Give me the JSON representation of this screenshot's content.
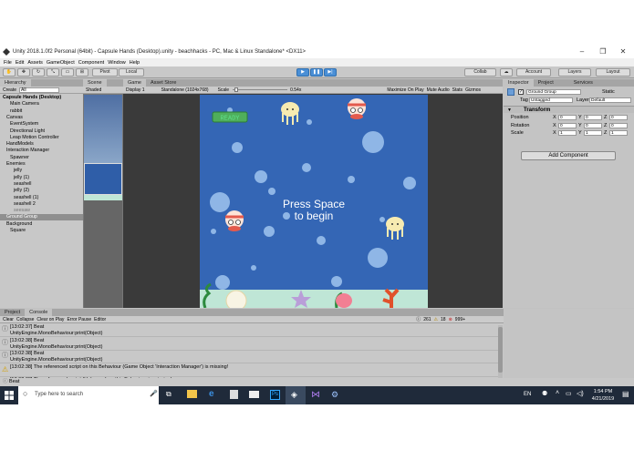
{
  "window": {
    "title": "Unity 2018.1.0f2 Personal (64bit) - Capsule Hands (Desktop).unity - beachhacks - PC, Mac & Linux Standalone* <DX11>"
  },
  "menu": [
    "File",
    "Edit",
    "Assets",
    "GameObject",
    "Component",
    "Window",
    "Help"
  ],
  "toolbar": {
    "pivot": "Pivot",
    "local": "Local",
    "collab": "Collab",
    "account": "Account",
    "layers": "Layers",
    "layout": "Layout"
  },
  "hierarchy": {
    "tab": "Hierarchy",
    "create": "Create",
    "search_placeholder": "All",
    "items": [
      {
        "label": "Capsule Hands (Desktop)",
        "indent": 0,
        "bold": true
      },
      {
        "label": "Main Camera",
        "indent": 2
      },
      {
        "label": "rabbit",
        "indent": 2
      },
      {
        "label": "Canvas",
        "indent": 1
      },
      {
        "label": "EventSystem",
        "indent": 2
      },
      {
        "label": "Directional Light",
        "indent": 2
      },
      {
        "label": "Leap Motion Controller",
        "indent": 2
      },
      {
        "label": "HandModels",
        "indent": 1
      },
      {
        "label": "Interaction Manager",
        "indent": 1
      },
      {
        "label": "Spawner",
        "indent": 2
      },
      {
        "label": "Enemies",
        "indent": 1
      },
      {
        "label": "jelly",
        "indent": 3
      },
      {
        "label": "jelly (1)",
        "indent": 3
      },
      {
        "label": "seashell",
        "indent": 3
      },
      {
        "label": "jelly (2)",
        "indent": 3
      },
      {
        "label": "seashell (1)",
        "indent": 3
      },
      {
        "label": "seashell 2",
        "indent": 3
      },
      {
        "label": "seesaw",
        "indent": 3,
        "dim": true
      },
      {
        "label": "Ground Group",
        "indent": 1,
        "selected": true
      },
      {
        "label": "Background",
        "indent": 1
      },
      {
        "label": "Square",
        "indent": 2
      }
    ]
  },
  "scene": {
    "tab": "Scene",
    "shading": "Shaded"
  },
  "game": {
    "tab": "Game",
    "asset_tab": "Asset Store",
    "display": "Display 1",
    "resolution": "Standalone (1024x768)",
    "scale_label": "Scale",
    "scale_value": "0.54x",
    "options": [
      "Maximize On Play",
      "Mute Audio",
      "Stats",
      "Gizmos"
    ],
    "ready": "READY",
    "prompt_line1": "Press Space",
    "prompt_line2": "to begin",
    "colors": {
      "sea": "#3466b5",
      "sand": "#bfe6d6",
      "ready": "#5ee08a"
    }
  },
  "inspector": {
    "tabs": [
      "Inspector",
      "Project",
      "Services"
    ],
    "object_name": "Ground Group",
    "static": "Static",
    "tag_label": "Tag",
    "tag_value": "Untagged",
    "layer_label": "Layer",
    "layer_value": "Default",
    "transform": "Transform",
    "position": {
      "label": "Position",
      "x": "0",
      "y": "0",
      "z": "0"
    },
    "rotation": {
      "label": "Rotation",
      "x": "0",
      "y": "0",
      "z": "0"
    },
    "scale": {
      "label": "Scale",
      "x": "1",
      "y": "1",
      "z": "1"
    },
    "add_component": "Add Component"
  },
  "console": {
    "tabs": [
      "Project",
      "Console"
    ],
    "buttons": [
      "Clear",
      "Collapse",
      "Clear on Play",
      "Error Pause",
      "Editor"
    ],
    "counts": {
      "logs": "261",
      "warnings": "18",
      "errors": "999+"
    },
    "entries": [
      {
        "type": "log",
        "line1": "[13:02:37] Beat",
        "line2": "UnityEngine.MonoBehaviour:print(Object)"
      },
      {
        "type": "log",
        "line1": "[13:02:38] Beat",
        "line2": "UnityEngine.MonoBehaviour:print(Object)"
      },
      {
        "type": "log",
        "line1": "[13:02:38] Beat",
        "line2": "UnityEngine.MonoBehaviour:print(Object)"
      },
      {
        "type": "warn",
        "line1": "[13:02:38] The referenced script on this Behaviour (Game Object 'Interaction Manager') is missing!",
        "line2": ""
      },
      {
        "type": "warn",
        "line1": "[13:02:38] The referenced script (Unknown) on this Behaviour is missing!",
        "line2": ""
      },
      {
        "type": "warn",
        "line1": "[13:02:38] The referenced script on this Behaviour (Game Object 'LeapHandController') is missing!",
        "line2": ""
      }
    ]
  },
  "status": "Beat",
  "taskbar": {
    "search_placeholder": "Type here to search",
    "lang": "EN",
    "time": "1:54 PM",
    "date": "4/21/2019"
  }
}
